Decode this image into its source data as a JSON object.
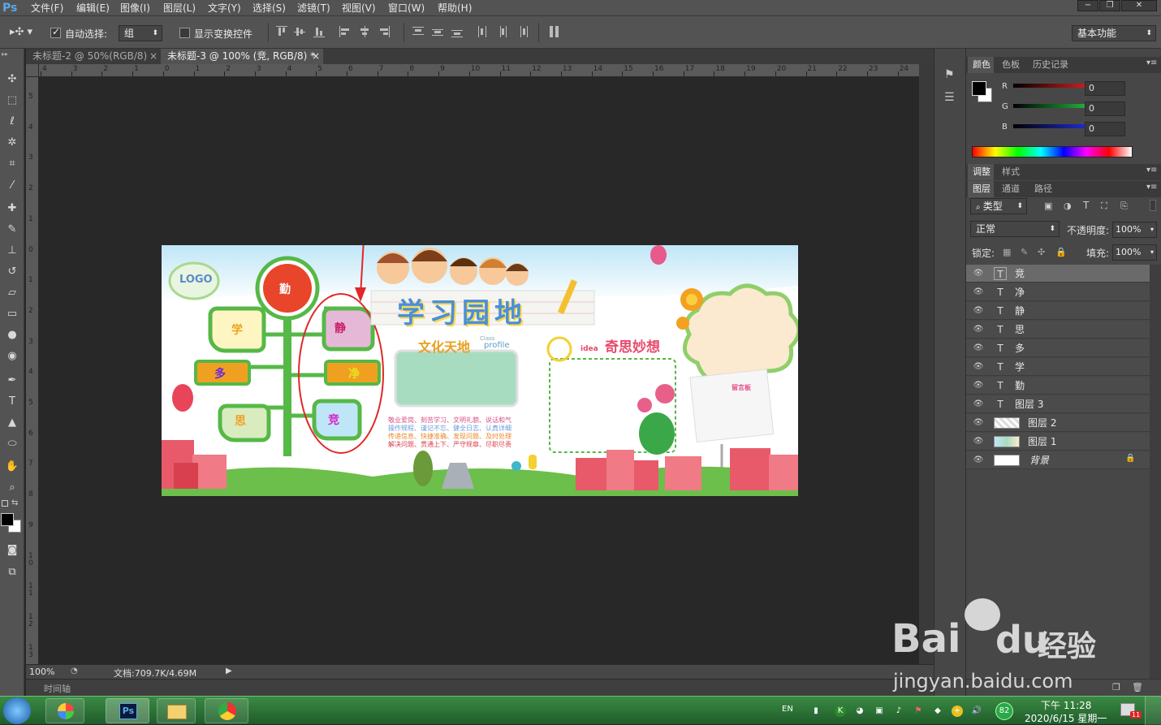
{
  "app": {
    "logo": "Ps"
  },
  "menu": [
    "文件(F)",
    "编辑(E)",
    "图像(I)",
    "图层(L)",
    "文字(Y)",
    "选择(S)",
    "滤镜(T)",
    "视图(V)",
    "窗口(W)",
    "帮助(H)"
  ],
  "window_controls": {
    "minimize": "−",
    "restore": "❐",
    "close": "✕"
  },
  "options": {
    "auto_select_label": "自动选择:",
    "auto_select_checked": true,
    "auto_select_value": "组",
    "show_transform_label": "显示变换控件",
    "workspace": "基本功能"
  },
  "tabs": [
    {
      "label": "未标题-2 @ 50%(RGB/8)",
      "close": "×",
      "active": false
    },
    {
      "label": "未标题-3 @ 100% (竞, RGB/8) *",
      "close": "×",
      "active": true
    }
  ],
  "ruler_top": [
    "4",
    "3",
    "2",
    "1",
    "0",
    "1",
    "2",
    "3",
    "4",
    "5",
    "6",
    "7",
    "8",
    "9",
    "10",
    "11",
    "12",
    "13",
    "14",
    "15",
    "16",
    "17",
    "18",
    "19",
    "20",
    "21",
    "22",
    "23",
    "24"
  ],
  "ruler_left": [
    "5",
    "4",
    "3",
    "2",
    "1",
    "0",
    "1",
    "2",
    "3",
    "4",
    "5",
    "6",
    "7",
    "8",
    "9",
    "1 0",
    "1 1",
    "1 2",
    "1 3"
  ],
  "status": {
    "zoom": "100%",
    "doc_info": "文档:709.7K/4.69M"
  },
  "timeline_label": "时间轴",
  "color_panel": {
    "tabs": [
      "颜色",
      "色板",
      "历史记录"
    ],
    "channels": [
      {
        "label": "R",
        "value": "0",
        "color": "#e02020"
      },
      {
        "label": "G",
        "value": "0",
        "color": "#20c040"
      },
      {
        "label": "B",
        "value": "0",
        "color": "#2030e0"
      }
    ]
  },
  "adjust_tabs": [
    "调整",
    "样式"
  ],
  "layers_panel": {
    "tabs": [
      "图层",
      "通道",
      "路径"
    ],
    "filter_kind": "类型",
    "blend_mode": "正常",
    "opacity_label": "不透明度:",
    "opacity": "100%",
    "lock_label": "锁定:",
    "fill_label": "填充:",
    "fill": "100%",
    "layers": [
      {
        "name": "竞",
        "type": "text",
        "selected": true
      },
      {
        "name": "净",
        "type": "text",
        "selected": false
      },
      {
        "name": "静",
        "type": "text",
        "selected": false
      },
      {
        "name": "思",
        "type": "text",
        "selected": false
      },
      {
        "name": "多",
        "type": "text",
        "selected": false
      },
      {
        "name": "学",
        "type": "text",
        "selected": false
      },
      {
        "name": "勤",
        "type": "text",
        "selected": false
      },
      {
        "name": "图层 3",
        "type": "text",
        "selected": false
      },
      {
        "name": "图层 2",
        "type": "pixel",
        "selected": false
      },
      {
        "name": "图层 1",
        "type": "pixel",
        "selected": false
      },
      {
        "name": "背景",
        "type": "background",
        "selected": false
      }
    ]
  },
  "document": {
    "logo_text": "LOGO",
    "title": "学习园地",
    "culture_title": "文化天地",
    "culture_sub_1": "Class",
    "culture_sub_2": "profile",
    "ideas_title": "奇思妙想",
    "ideas_badge": "idea",
    "board_label": "留言板",
    "body_lines": [
      "敬业爱岗、刻苦学习、文明礼貌、说话和气",
      "操作规程、谨记不忘、健全日志、认真详细",
      "传递信息、快捷准确、发现问题、及时处理",
      "解决问题、贯通上下、严守规章、尽职尽责"
    ],
    "tree_chars": {
      "top": "勤",
      "left1": "学",
      "left2": "多",
      "left3": "思",
      "right1": "静",
      "right2": "净",
      "right3": "竞"
    },
    "colors": {
      "tree_green": "#56b847",
      "top_red": "#e8452a",
      "orange_bar": "#f0a020"
    }
  },
  "taskbar": {
    "clock_time": "下午 11:28",
    "clock_date": "2020/6/15 星期一",
    "lang": "EN",
    "tray_badge": "82",
    "notify_count": "11"
  },
  "watermark": {
    "brand": "Bai",
    "brand2": "du",
    "jingyan": "经验",
    "url": "jingyan.baidu.com"
  }
}
